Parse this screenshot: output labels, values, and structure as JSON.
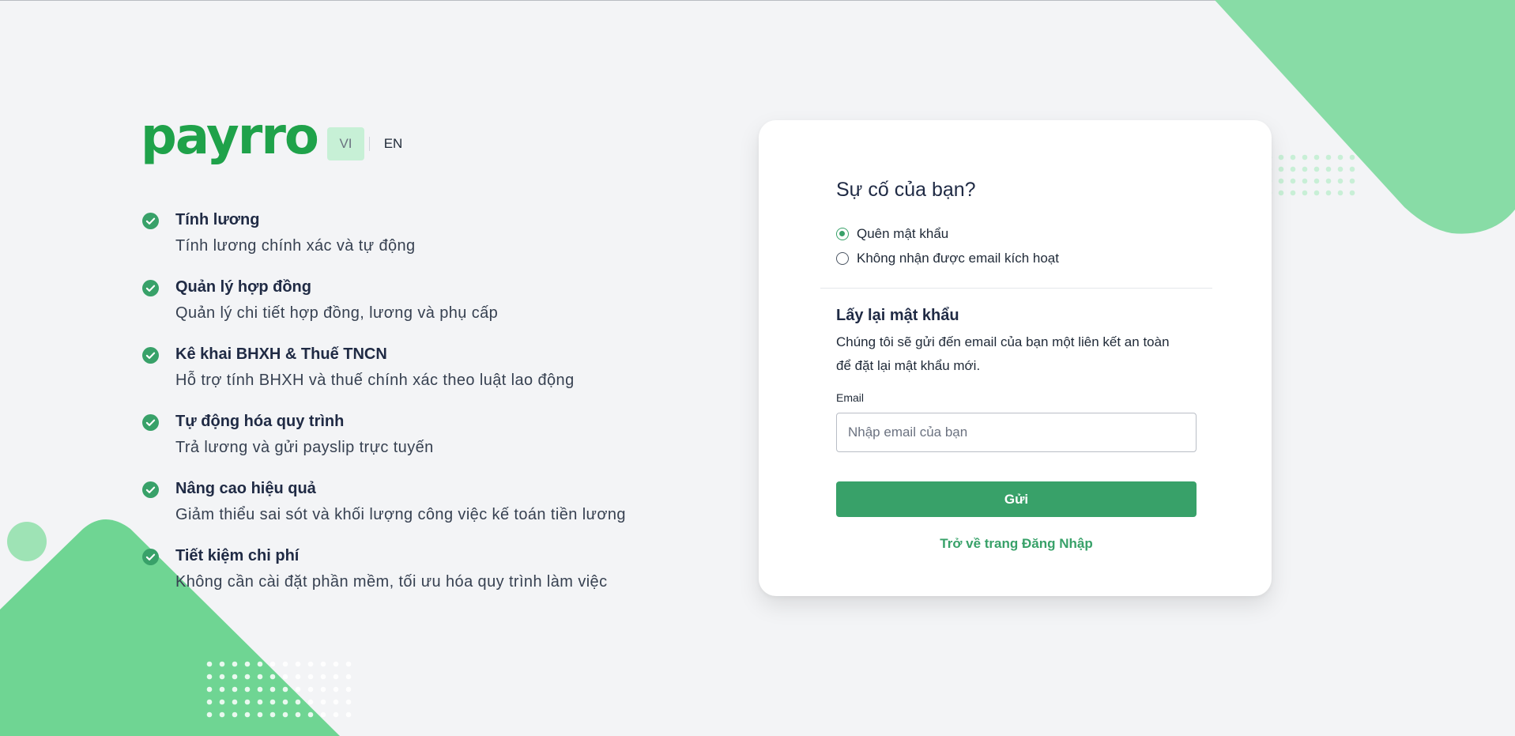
{
  "brand": {
    "logo_text": "payrro",
    "color": "#1fa24a"
  },
  "language": {
    "active": "VI",
    "options": [
      "VI",
      "EN"
    ]
  },
  "features": [
    {
      "title": "Tính lương",
      "description": "Tính lương chính xác và tự động"
    },
    {
      "title": "Quản lý hợp đồng",
      "description": "Quản lý chi tiết hợp đồng, lương và phụ cấp"
    },
    {
      "title": "Kê khai BHXH & Thuế TNCN",
      "description": "Hỗ trợ tính BHXH và thuế chính xác theo luật lao động"
    },
    {
      "title": "Tự động hóa quy trình",
      "description": "Trả lương và gửi payslip trực tuyến"
    },
    {
      "title": "Nâng cao hiệu quả",
      "description": "Giảm thiểu sai sót và khối lượng công việc kế toán tiền lương"
    },
    {
      "title": "Tiết kiệm chi phí",
      "description": "Không cần cài đặt phần mềm, tối ưu hóa quy trình làm việc"
    }
  ],
  "card": {
    "title": "Sự cố của bạn?",
    "options": [
      {
        "label": "Quên mật khẩu",
        "selected": true
      },
      {
        "label": "Không nhận được email kích hoạt",
        "selected": false
      }
    ],
    "section_title": "Lấy lại mật khẩu",
    "section_desc": "Chúng tôi sẽ gửi đến email của bạn một liên kết an toàn để đặt lại mật khẩu mới.",
    "email_label": "Email",
    "email_placeholder": "Nhập email của bạn",
    "email_value": "",
    "submit_label": "Gửi",
    "back_link": "Trở về trang Đăng Nhập"
  },
  "colors": {
    "accent": "#38a169",
    "decor_green": "#6fd593",
    "background": "#f3f4f6"
  },
  "icons": {
    "feature_check": "check-circle-icon"
  }
}
